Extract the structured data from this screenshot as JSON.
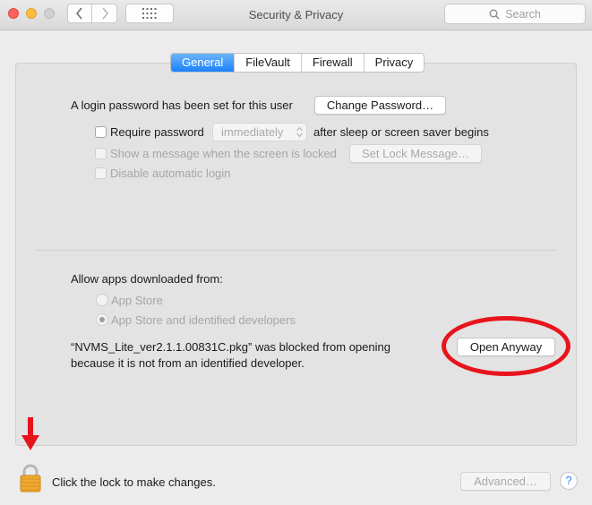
{
  "window": {
    "title": "Security & Privacy"
  },
  "toolbar": {
    "back_icon": "chevron-left-icon",
    "forward_icon": "chevron-right-icon",
    "grid_icon": "grid-icon",
    "search_placeholder": "Search"
  },
  "tabs": [
    {
      "label": "General",
      "active": true
    },
    {
      "label": "FileVault",
      "active": false
    },
    {
      "label": "Firewall",
      "active": false
    },
    {
      "label": "Privacy",
      "active": false
    }
  ],
  "general": {
    "login_text": "A login password has been set for this user",
    "change_password_label": "Change Password…",
    "require_password_label": "Require password",
    "require_password_delay": "immediately",
    "require_password_suffix": "after sleep or screen saver begins",
    "show_message_label": "Show a message when the screen is locked",
    "set_lock_message_label": "Set Lock Message…",
    "disable_autologin_label": "Disable automatic login"
  },
  "apps": {
    "allow_label": "Allow apps downloaded from:",
    "option_app_store": "App Store",
    "option_identified": "App Store and identified developers",
    "blocked_line1": "“NVMS_Lite_ver2.1.1.00831C.pkg” was blocked from opening",
    "blocked_line2": "because it is not from an identified developer.",
    "open_anyway_label": "Open Anyway"
  },
  "footer": {
    "lock_text": "Click the lock to make changes.",
    "advanced_label": "Advanced…",
    "help_label": "?"
  },
  "colors": {
    "accent_blue": "#1a82fb",
    "annotation_red": "#e8141c",
    "lock_gold": "#f0a830"
  }
}
